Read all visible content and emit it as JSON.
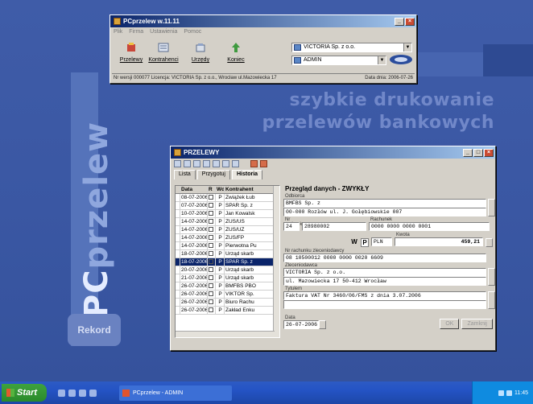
{
  "desktop": {
    "logo_word_a": "PC",
    "logo_word_b": "przelew",
    "logo_badge": "Rekord",
    "tagline_1": "szybkie drukowanie",
    "tagline_2": "przelewów bankowych"
  },
  "launcher": {
    "title": "PCprzelew w.11.11",
    "menu": [
      "Plik",
      "Firma",
      "Ustawienia",
      "Pomoc"
    ],
    "buttons": [
      {
        "label": "Przelewy",
        "icon": "money-icon"
      },
      {
        "label": "Kontrahenci",
        "icon": "contacts-icon"
      },
      {
        "label": "Urzędy",
        "icon": "office-icon"
      },
      {
        "label": "Koniec",
        "icon": "exit-icon"
      }
    ],
    "company_combo": "VICTORIA Sp. z o.o.",
    "user_combo": "ADMIN",
    "status_left": "Nr wersji 000077 Licencja: VICTORIA Sp. z o.o., Wrocław ul.Mazowiecka 17",
    "status_right": "Data dnia: 2006-07-26"
  },
  "przelewy": {
    "title": "PRZELEWY",
    "tabs": [
      "Lista",
      "Przygotuj",
      "Historia"
    ],
    "active_tab": "Historia",
    "columns": [
      "Data",
      "R",
      "Wd",
      "Kontrahent"
    ],
    "rows": [
      {
        "date": "08-07-2006",
        "r": "",
        "wd": "P",
        "name": "Zwiążek Łub"
      },
      {
        "date": "07-07-2006",
        "r": "",
        "wd": "P",
        "name": "SPAR Sp. z"
      },
      {
        "date": "10-07-2006",
        "r": "",
        "wd": "P",
        "name": "Jan Kowalsk"
      },
      {
        "date": "14-07-2006",
        "r": "",
        "wd": "P",
        "name": "ZUS/US"
      },
      {
        "date": "14-07-2006",
        "r": "",
        "wd": "P",
        "name": "ZUS/UZ"
      },
      {
        "date": "14-07-2006",
        "r": "",
        "wd": "P",
        "name": "ZUS/FP"
      },
      {
        "date": "14-07-2006",
        "r": "",
        "wd": "P",
        "name": "Pierwotna Pu"
      },
      {
        "date": "18-07-2006",
        "r": "",
        "wd": "P",
        "name": "Urząd skarb"
      },
      {
        "date": "18-07-2006",
        "r": "",
        "wd": "P",
        "name": "SPAR Sp. z"
      },
      {
        "date": "20-07-2006",
        "r": "",
        "wd": "P",
        "name": "Urząd skarb"
      },
      {
        "date": "21-07-2006",
        "r": "",
        "wd": "P",
        "name": "Urząd skarb"
      },
      {
        "date": "26-07-2006",
        "r": "",
        "wd": "P",
        "name": "BMFBS PBO"
      },
      {
        "date": "26-07-2006",
        "r": "",
        "wd": "P",
        "name": "VIKTOR Sp."
      },
      {
        "date": "26-07-2006",
        "r": "",
        "wd": "P",
        "name": "Biuro Rachu"
      },
      {
        "date": "26-07-2006",
        "r": "",
        "wd": "P",
        "name": "Zakład Enku"
      }
    ],
    "selected_row": 8,
    "detail": {
      "header": "Przegląd danych - ZWYKŁY",
      "label_beneficiary": "Odbiorca",
      "beneficiary_1": "BMFBS Sp. z",
      "beneficiary_2": "00-000 Rozłów  ul. J. Gołębiowskie 007",
      "label_bank": "Nr rachunku",
      "label_account": "Rachunek",
      "bank_code": "24",
      "bank_id": "28980002",
      "account_no": "0000 0000 0000 0001",
      "w_label": "W",
      "p_label": "P",
      "currency": "PLN",
      "label_amount": "Kwota",
      "amount": "459,21",
      "label_sender_account": "Nr rachunku zleceniodawcy",
      "sender_account": "08 10500012 0000 0000 0020 6609",
      "label_sender": "Zleceniodawca",
      "sender_1": "VICTORIA Sp. z o.o.",
      "sender_2": "ul. Mazowiecka 17 50-412 Wrocław",
      "label_title": "Tytułem",
      "title_1": "Faktura VAT Nr 3460/06/FMS z dnia 3.07.2006",
      "label_date": "Data",
      "date": "26-07-2006",
      "btn_ok": "OK",
      "btn_cancel": "Zamknij"
    }
  },
  "taskbar": {
    "start": "Start",
    "task_label": "PCprzelew - ADMIN",
    "clock": "11:45"
  }
}
